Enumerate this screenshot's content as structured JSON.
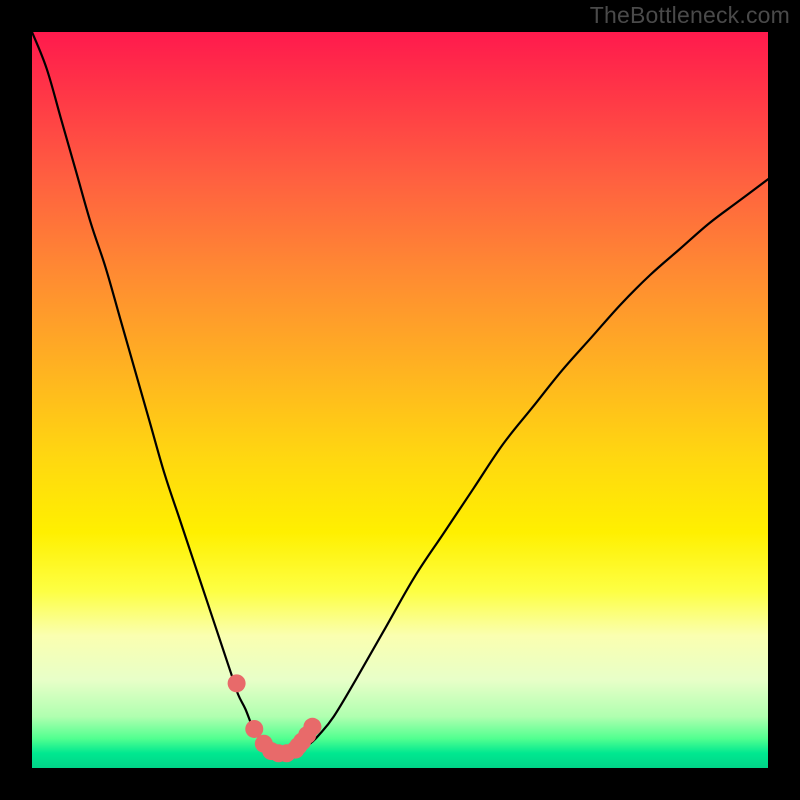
{
  "watermark": "TheBottleneck.com",
  "colors": {
    "frame": "#000000",
    "curve": "#000000",
    "marker": "#e86a6a"
  },
  "chart_data": {
    "type": "line",
    "title": "",
    "xlabel": "",
    "ylabel": "",
    "xlim": [
      0,
      100
    ],
    "ylim": [
      0,
      100
    ],
    "x": [
      0,
      2,
      4,
      6,
      8,
      10,
      12,
      14,
      16,
      18,
      20,
      22,
      24,
      26,
      27,
      28,
      29,
      30,
      31,
      32,
      33,
      34,
      35,
      36,
      37,
      38,
      39,
      41,
      44,
      48,
      52,
      56,
      60,
      64,
      68,
      72,
      76,
      80,
      84,
      88,
      92,
      96,
      100
    ],
    "y": [
      100,
      95,
      88,
      81,
      74,
      68,
      61,
      54,
      47,
      40,
      34,
      28,
      22,
      16,
      13,
      10,
      8,
      5.5,
      4,
      3,
      2.3,
      2,
      2,
      2.2,
      2.7,
      3.5,
      4.5,
      7,
      12,
      19,
      26,
      32,
      38,
      44,
      49,
      54,
      58.5,
      63,
      67,
      70.5,
      74,
      77,
      80
    ],
    "markers": {
      "x": [
        27.8,
        30.2,
        31.5,
        32.5,
        33.5,
        34.6,
        35.8,
        36.2,
        36.7,
        37.4,
        38.1
      ],
      "y": [
        11.5,
        5.3,
        3.3,
        2.3,
        2.0,
        2.0,
        2.5,
        3.0,
        3.6,
        4.5,
        5.6
      ]
    }
  }
}
